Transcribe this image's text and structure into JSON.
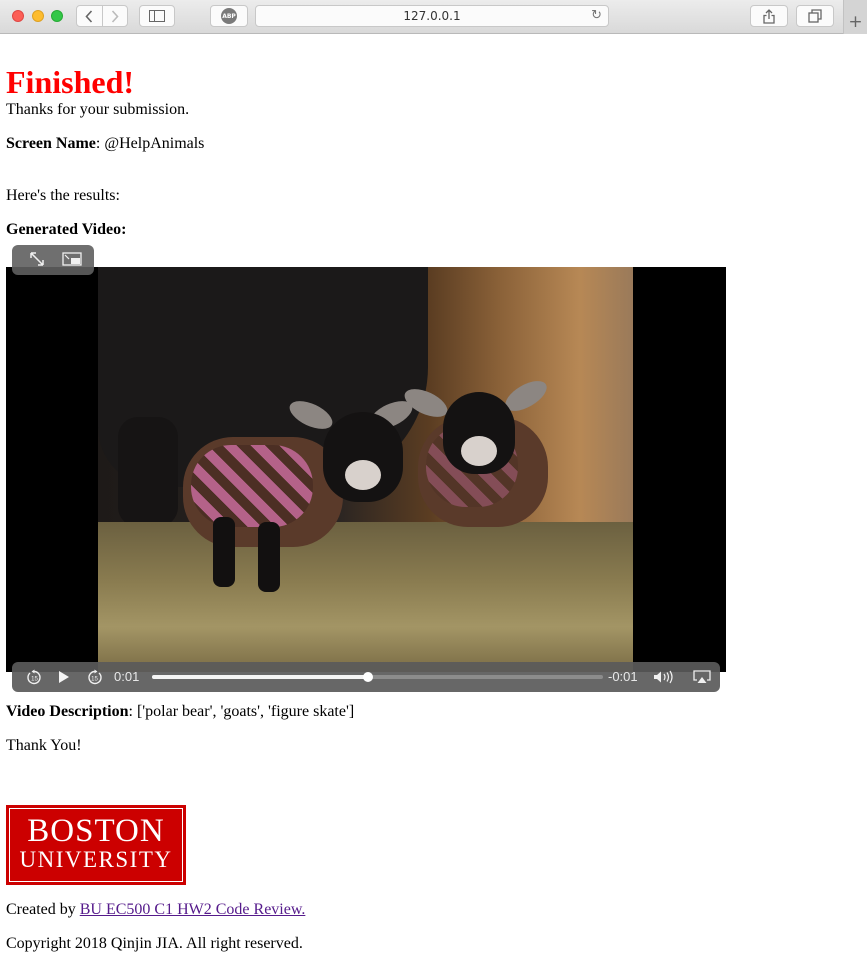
{
  "browser": {
    "url": "127.0.0.1",
    "abp_label": "ABP",
    "new_tab_label": "+"
  },
  "page": {
    "title": "Finished!",
    "thanks": "Thanks for your submission.",
    "screen_name_label": "Screen Name",
    "screen_name_value": ": @HelpAnimals",
    "results_intro": "Here's the results:",
    "generated_video_label": "Generated Video:",
    "video": {
      "elapsed": "0:01",
      "remaining": "-0:01",
      "progress": 0.48
    },
    "video_description_label": "Video Description",
    "video_description_value": ": ['polar bear', 'goats', 'figure skate']",
    "thank_you": "Thank You!",
    "logo": {
      "line1": "BOSTON",
      "line2": "UNIVERSITY",
      "color": "#cc0000"
    },
    "created_by_prefix": "Created by ",
    "created_by_link": "BU EC500 C1 HW2 Code Review.",
    "copyright": "Copyright 2018 Qinjin JIA. All right reserved."
  },
  "colors": {
    "title": "#ff0000",
    "link": "#551a8b"
  }
}
